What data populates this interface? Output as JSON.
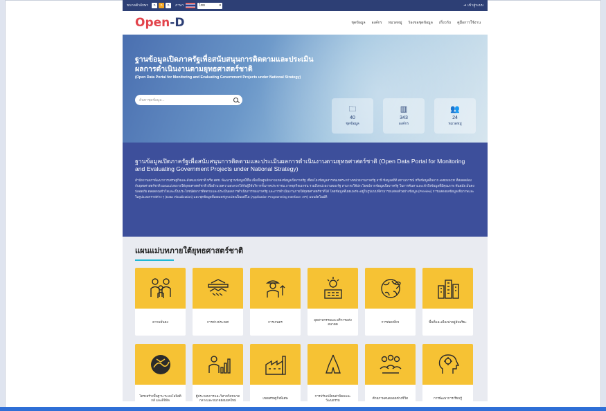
{
  "topbar": {
    "font_size_label": "ขนาดตัวอักษร",
    "font_buttons": [
      "ก",
      "ก",
      "ก"
    ],
    "language_label": "ภาษา",
    "language_value": "ไทย",
    "login_label": "เข้าสู่ระบบ"
  },
  "nav": {
    "logo_part1": "O",
    "logo_part2": "pen",
    "logo_part3": "-D",
    "menu": [
      "ชุดข้อมูล",
      "องค์กร",
      "หมวดหมู่",
      "ร้องขอชุดข้อมูล",
      "เกี่ยวกับ",
      "คู่มือการใช้งาน"
    ]
  },
  "hero": {
    "title": "ฐานข้อมูลเปิดภาครัฐเพื่อสนับสนุนการติดตามและประเมินผลการดำเนินงานตามยุทธศาสตร์ชาติ",
    "subtitle": "(Open Data Portal for Monitoring and Evaluating Government Projects under National Strategy)",
    "search_placeholder": "ค้นหาชุดข้อมูล...",
    "stats": [
      {
        "icon": "folder-icon",
        "value": "40",
        "label": "ชุดข้อมูล"
      },
      {
        "icon": "building-icon",
        "value": "343",
        "label": "องค์กร"
      },
      {
        "icon": "users-icon",
        "value": "24",
        "label": "หมวดหมู่"
      }
    ]
  },
  "about": {
    "title": "ฐานข้อมูลเปิดภาครัฐเพื่อสนับสนุนการติดตามและประเมินผลการดำเนินงานตามยุทธศาสตร์ชาติ (Open Data Portal for Monitoring and Evaluating Government Projects under National Strategy)",
    "body": "สำนักงานสภาพัฒนาการเศรษฐกิจและสังคมแห่งชาติ หรือ สศช. พัฒนาฐานข้อมูลนี้ขึ้น เพื่อเป็นศูนย์กลางแหล่งข้อมูลเปิดภาครัฐ เชื่อมโยงข้อมูลสารสนเทศระหว่างหน่วยงานภาครัฐ อาทิ ข้อมูลสถิติ สถานการณ์ หรือข้อมูลอื่นจาก eMENSCR ที่สอดคล้องกับยุทธศาสตร์ชาติ แผนแม่บทภายใต้ยุทธศาสตร์ชาติ เพื่ออำนวยความสะดวกให้กับผู้ใช้บริการทั้งภาคประชาชน ภาคธุรกิจเอกชน รวมถึงหน่วยงานของรัฐ สามารถใช้ประโยชน์จากข้อมูลเปิดภาครัฐ ในการค้นหาและเข้าถึงข้อมูลที่มีคุณภาพ ทันสมัย มั่นคงปลอดภัย ตลอดจนเข้าใจและเป็นประโยชน์ต่อการติดตามและประเมินผลการดำเนินการของภาครัฐ และการดำเนินงานภายใต้ยุทธศาสตร์ชาติได้ โดยข้อมูลที่เผยแพร่จะอยู่ในรูปแบบที่สามารถแสดงตัวอย่างข้อมูล (Preview) การแสดงผลข้อมูลเชิงภาพและในรูปแบบกราฟต่าง ๆ (Data Visualization) และชุดข้อมูลที่เผยแพร่ถูกแปลงเป็นเอพีไอ (Application Programming Interface: API) แบบอัตโนมัติ"
  },
  "strategy": {
    "title": "แผนแม่บทภายใต้ยุทธศาสตร์ชาติ",
    "cards": [
      {
        "icon": "family-icon",
        "label": "ความมั่นคง"
      },
      {
        "icon": "handshake-icon",
        "label": "การต่างประเทศ"
      },
      {
        "icon": "farmer-icon",
        "label": "การเกษตร"
      },
      {
        "icon": "industry-icon",
        "label": "อุตสาหกรรมและบริการแห่งอนาคต"
      },
      {
        "icon": "globe-icon",
        "label": "การท่องเที่ยว"
      },
      {
        "icon": "city-icon",
        "label": "พื้นที่และเมืองน่าอยู่อัจฉริยะ"
      },
      {
        "icon": "transport-icon",
        "label": "โครงสร้างพื้นฐาน ระบบโลจิสติกส์ และดิจิทัล"
      },
      {
        "icon": "entrepreneur-icon",
        "label": "ผู้ประกอบการและวิสาหกิจขนาดกลางและขนาดย่อมยุคใหม่"
      },
      {
        "icon": "factory-icon",
        "label": "เขตเศรษฐกิจพิเศษ"
      },
      {
        "icon": "praying-hands-icon",
        "label": "การปรับเปลี่ยนค่านิยมและวัฒนธรรม"
      },
      {
        "icon": "people-icon",
        "label": "ศักยภาพคนตลอดช่วงชีวิต"
      },
      {
        "icon": "brain-icon",
        "label": "การพัฒนาการเรียนรู้"
      }
    ]
  }
}
